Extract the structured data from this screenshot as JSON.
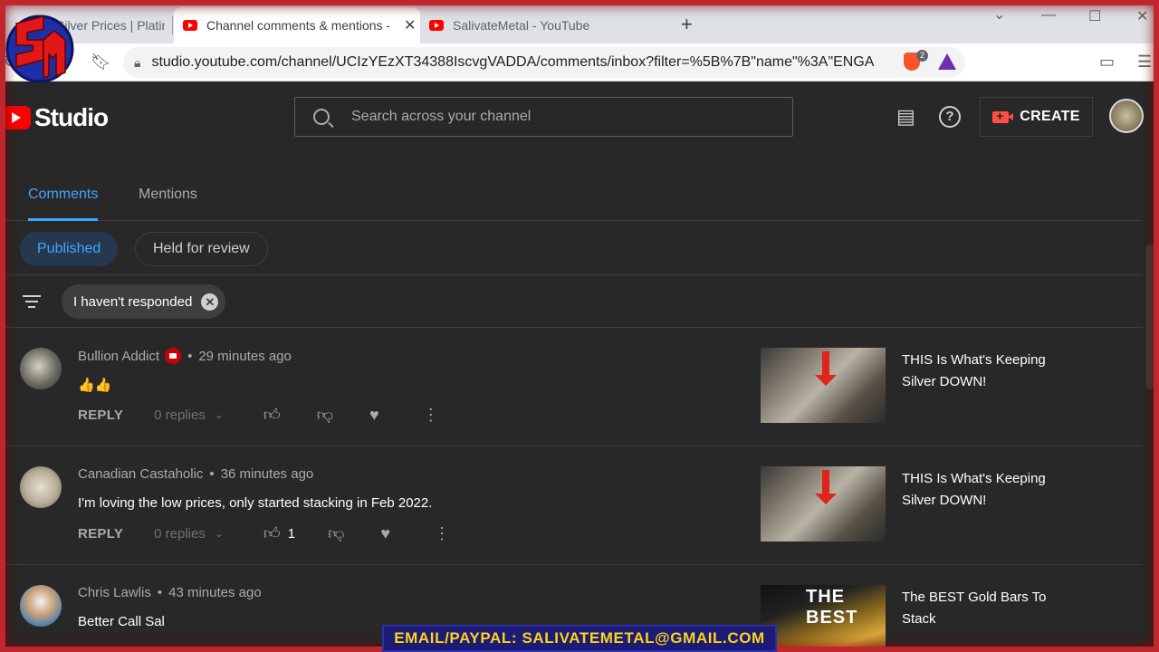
{
  "browser": {
    "tabs": [
      {
        "title": "Silver Prices | Platinu",
        "active": false
      },
      {
        "title": "Channel comments & mentions -",
        "active": true
      },
      {
        "title": "SalivateMetal - YouTube",
        "active": false
      }
    ],
    "url": "studio.youtube.com/channel/UCIzYEzXT34388IscvgVADDA/comments/inbox?filter=%5B%7B\"name\"%3A\"ENGA...",
    "brave_count": "2",
    "icons": {
      "new_tab": "+",
      "minimize": "—",
      "maximize": "☐",
      "close": "✕",
      "dropdown": "⌄"
    }
  },
  "studio": {
    "logo_text": "Studio",
    "search_placeholder": "Search across your channel",
    "create_label": "CREATE",
    "tabs": [
      "Comments",
      "Mentions"
    ],
    "chips": {
      "published": "Published",
      "held": "Held for review"
    },
    "filter_chip": "I haven't responded"
  },
  "comments": [
    {
      "author": "Bullion Addict",
      "has_badge": true,
      "time": "29 minutes ago",
      "text": "👍👍",
      "reply_label": "REPLY",
      "replies": "0 replies",
      "likes": "",
      "video_title": "THIS Is What's Keeping Silver DOWN!"
    },
    {
      "author": "Canadian Castaholic",
      "has_badge": false,
      "time": "36 minutes ago",
      "text": "I'm loving the low prices, only started stacking in Feb 2022.",
      "reply_label": "REPLY",
      "replies": "0 replies",
      "likes": "1",
      "video_title": "THIS Is What's Keeping Silver DOWN!"
    },
    {
      "author": "Chris Lawlis",
      "has_badge": false,
      "time": "43 minutes ago",
      "text": "Better Call Sal",
      "reply_label": "REPLY",
      "replies": "0 replies",
      "likes": "",
      "video_title": "The BEST Gold Bars To Stack",
      "thumb_text": "THE BEST"
    }
  ],
  "overlay": {
    "banner": "EMAIL/PAYPAL: SALIVATEMETAL@GMAIL.COM"
  },
  "colors": {
    "accent": "#3ea6ff",
    "bg": "#282828",
    "brand_red": "#ff0000",
    "frame": "#c0262b"
  }
}
